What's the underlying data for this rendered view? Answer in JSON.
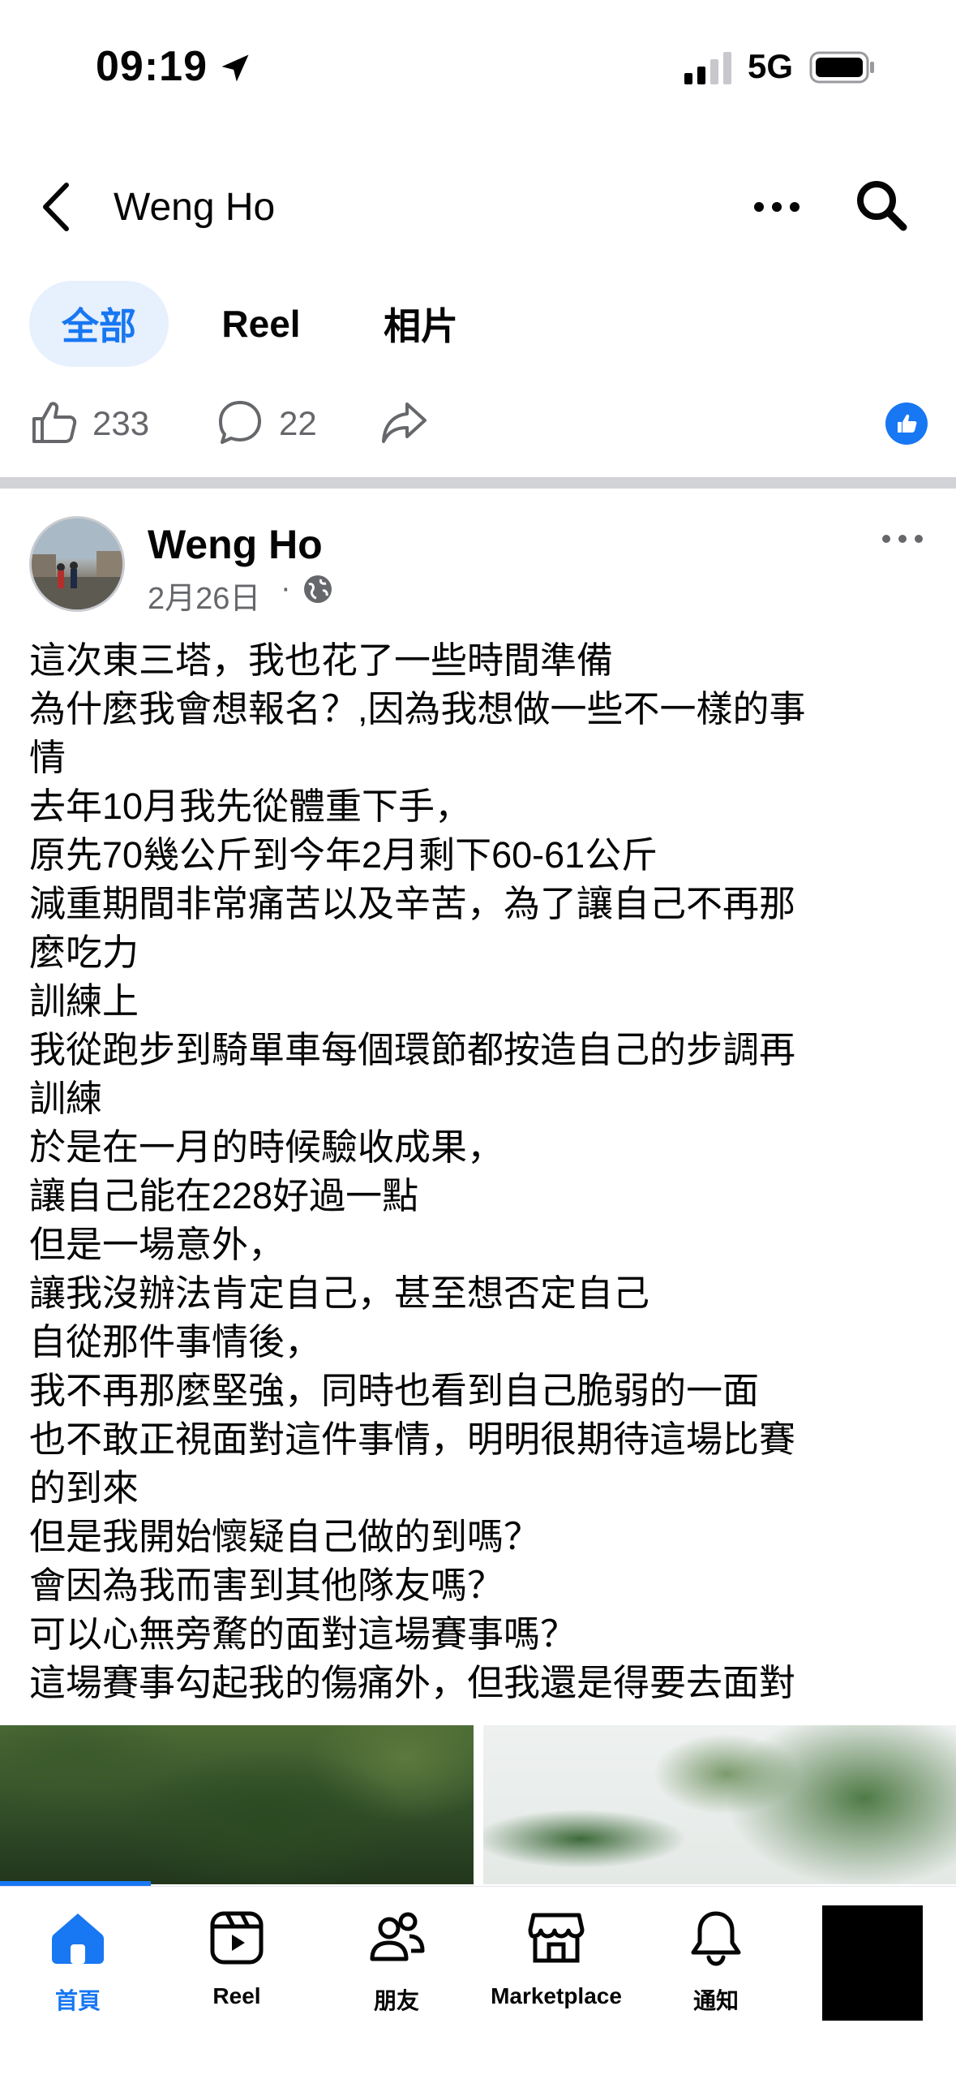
{
  "status_bar": {
    "time": "09:19",
    "network": "5G"
  },
  "header": {
    "title": "Weng Ho"
  },
  "tabs": [
    {
      "label": "全部",
      "active": true
    },
    {
      "label": "Reel",
      "active": false
    },
    {
      "label": "相片",
      "active": false
    }
  ],
  "stats": {
    "likes": "233",
    "comments": "22"
  },
  "post": {
    "author": "Weng Ho",
    "date": "2月26日",
    "separator": "·",
    "lines": [
      "這次東三塔，我也花了一些時間準備",
      "為什麼我會想報名？,因為我想做一些不一樣的事",
      "情",
      "去年10月我先從體重下手，",
      "原先70幾公斤到今年2月剩下60-61公斤",
      "減重期間非常痛苦以及辛苦，為了讓自己不再那",
      "麼吃力",
      "訓練上",
      "我從跑步到騎單車每個環節都按造自己的步調再",
      "訓練",
      "於是在一月的時候驗收成果，",
      "讓自己能在228好過一點",
      "但是一場意外，",
      "讓我沒辦法肯定自己，甚至想否定自己",
      "自從那件事情後，",
      "我不再那麼堅強，同時也看到自己脆弱的一面",
      "也不敢正視面對這件事情，明明很期待這場比賽",
      "的到來",
      "但是我開始懷疑自己做的到嗎？",
      "會因為我而害到其他隊友嗎？",
      "可以心無旁騖的面對這場賽事嗎？",
      "這場賽事勾起我的傷痛外，但我還是得要去面對"
    ]
  },
  "bottom_nav": [
    {
      "label": "首頁",
      "icon": "home-icon",
      "active": true
    },
    {
      "label": "Reel",
      "icon": "reel-icon",
      "active": false
    },
    {
      "label": "朋友",
      "icon": "friends-icon",
      "active": false
    },
    {
      "label": "Marketplace",
      "icon": "marketplace-icon",
      "active": false
    },
    {
      "label": "通知",
      "icon": "bell-icon",
      "active": false
    }
  ],
  "colors": {
    "accent": "#1877f2",
    "muted": "#65676b",
    "tab_active_bg": "#e7f0fd",
    "divider": "#d2d3d6"
  }
}
